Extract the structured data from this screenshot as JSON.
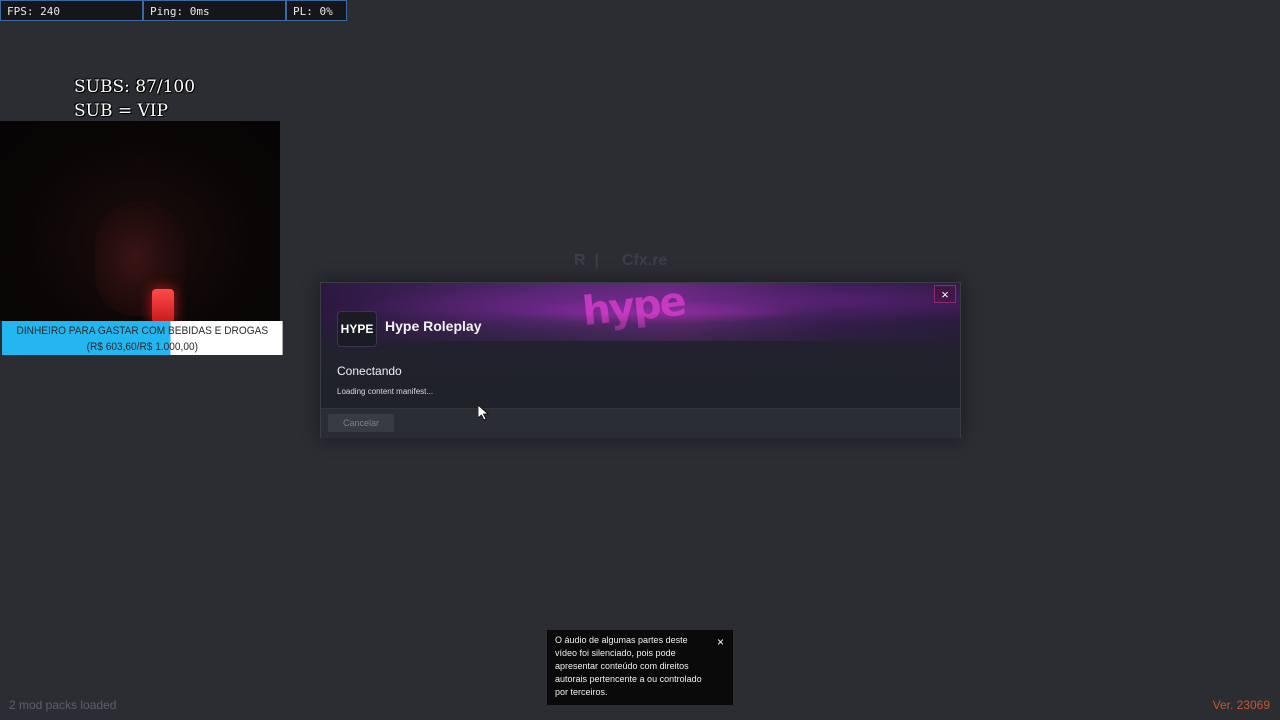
{
  "stats": {
    "fps": "FPS: 240",
    "ping": "Ping: 0ms",
    "pl": "PL: 0%"
  },
  "overlay": {
    "subs_line1": "SUBS: 87/100",
    "subs_line2": "SUB = VIP",
    "goal_line1": "DINHEIRO PARA GASTAR COM BEBIDAS E DROGAS",
    "goal_line2": "(R$ 603,60/R$ 1.000,00)",
    "goal_progress": 0.6036
  },
  "background_window": {
    "ghost_text": "Cfx.re"
  },
  "dialog": {
    "server_name": "Hype Roleplay",
    "logo_text": "HYPE",
    "banner_word": "hype",
    "close_label": "×",
    "status_title": "Conectando",
    "status_message": "Loading content manifest...",
    "cancel_label": "Cancelar"
  },
  "notice": {
    "text": "O áudio de algumas partes deste vídeo foi silenciado, pois pode apresentar conteúdo com direitos autorais pertencente a ou controlado por terceiros.",
    "close_label": "×"
  },
  "footer": {
    "mods_text": "2 mod packs loaded",
    "version_text": "Ver. 23069"
  },
  "colors": {
    "background": "#2b2d33",
    "accent_purple": "#e03fcf",
    "version_orange": "#c8562a",
    "goal_blue": "#24b6f0"
  },
  "icons": {
    "close": "close-icon",
    "cursor": "cursor-icon",
    "logo": "server-logo-icon"
  }
}
